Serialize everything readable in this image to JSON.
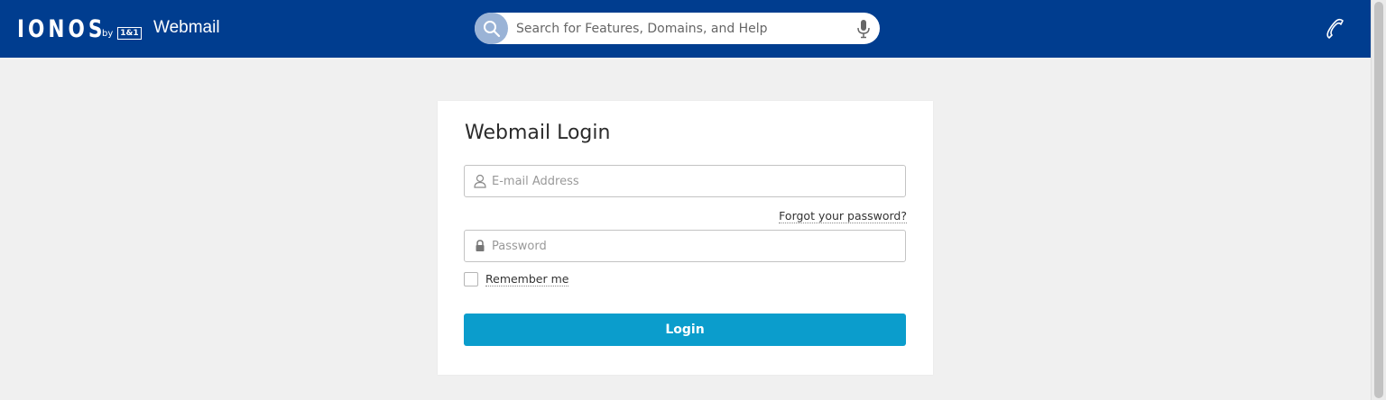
{
  "header": {
    "logo_text": "IONOS",
    "logo_by": "by",
    "logo_badge": "1&1",
    "app_name": "Webmail",
    "background_color": "#003d8f",
    "search": {
      "placeholder": "Search for Features, Domains, and Help",
      "icon": "search-icon",
      "mic_icon": "microphone-icon"
    },
    "phone_icon": "phone-icon"
  },
  "login": {
    "title": "Webmail Login",
    "email": {
      "placeholder": "E-mail Address",
      "icon": "user-icon"
    },
    "forgot_password": "Forgot your password?",
    "password": {
      "placeholder": "Password",
      "icon": "lock-icon"
    },
    "remember_me": "Remember me",
    "remember_checked": false,
    "login_button": "Login",
    "button_color": "#0b9dcc"
  }
}
